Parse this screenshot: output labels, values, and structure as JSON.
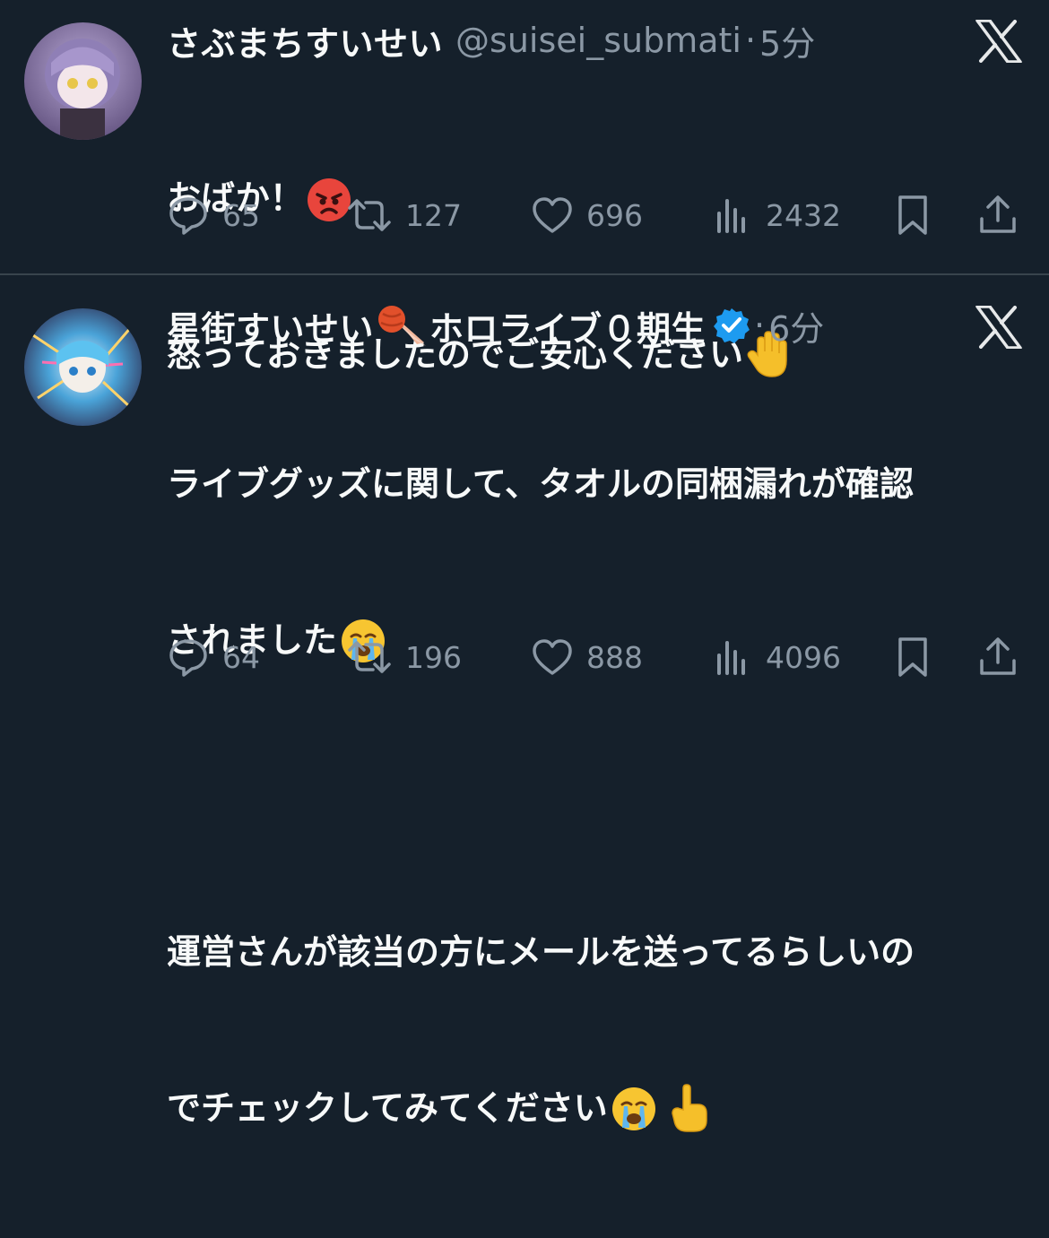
{
  "tweets": [
    {
      "display_name": "さぶまちすいせい",
      "handle": "@suisei_submati",
      "separator": "·",
      "time": "5分",
      "lines": [
        "おばか！",
        "怒っておきましたのでご安心ください"
      ],
      "emojis": [
        "pouting-face",
        "raised-hand"
      ],
      "counts": {
        "replies": "65",
        "retweets": "127",
        "likes": "696",
        "views": "2432"
      }
    },
    {
      "display_name": "星街すいせい",
      "display_name_suffix": "ホロライブ０期生",
      "verified": true,
      "separator": "·",
      "time": "6分",
      "lines": [
        "ライブグッズに関して、タオルの同梱漏れが確認",
        "されました",
        "",
        "運営さんが該当の方にメールを送ってるらしいの",
        "でチェックしてみてください"
      ],
      "emojis": [
        "comet",
        "crying-face",
        "crying-face",
        "pointing-up"
      ],
      "counts": {
        "replies": "64",
        "retweets": "196",
        "likes": "888",
        "views": "4096"
      }
    }
  ],
  "colors": {
    "background": "#15202b",
    "text": "#f7f9f9",
    "secondary": "#8b98a5",
    "divider": "#38444d",
    "verified": "#1d9bf0"
  }
}
